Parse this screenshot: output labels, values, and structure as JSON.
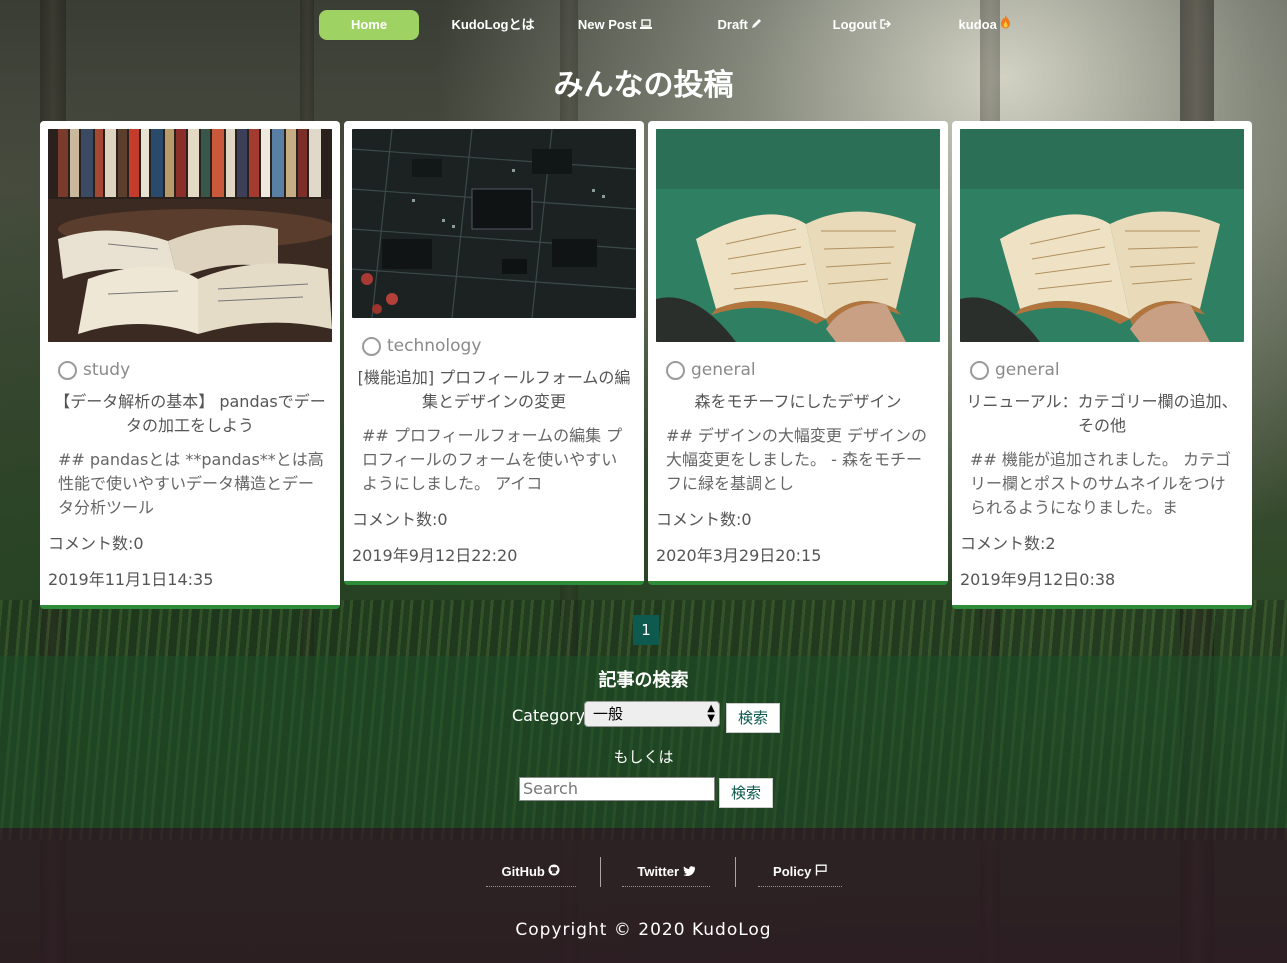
{
  "nav": {
    "home": "Home",
    "about": "KudoLogとは",
    "new_post": "New Post",
    "draft": "Draft",
    "logout": "Logout",
    "user": "kudoa"
  },
  "page_title": "みんなの投稿",
  "posts": [
    {
      "category": "study",
      "title": "【データ解析の基本】 pandasでデータの加工をしよう",
      "excerpt": "## pandasとは **pandas**とは高性能で使いやすいデータ構造とデータ分析ツール",
      "comments": "コメント数:0",
      "date": "2019年11月1日14:35",
      "image": "books-photo"
    },
    {
      "category": "technology",
      "title": "[機能追加] プロフィールフォームの編集とデザインの変更",
      "excerpt": "## プロフィールフォームの編集 プロフィールのフォームを使いやすいようにしました。 アイコ",
      "comments": "コメント数:0",
      "date": "2019年9月12日22:20",
      "image": "circuit-board-photo"
    },
    {
      "category": "general",
      "title": "森をモチーフにしたデザイン",
      "excerpt": "## デザインの大幅変更 デザインの大幅変更をしました。 - 森をモチーフに緑を基調とし",
      "comments": "コメント数:0",
      "date": "2020年3月29日20:15",
      "image": "reading-photo"
    },
    {
      "category": "general",
      "title": "リニューアル：カテゴリー欄の追加、その他",
      "excerpt": "## 機能が追加されました。 カテゴリー欄とポストのサムネイルをつけられるようになりました。ま",
      "comments": "コメント数:2",
      "date": "2019年9月12日0:38",
      "image": "reading-photo"
    }
  ],
  "pagination": {
    "current": "1"
  },
  "search": {
    "title": "記事の検索",
    "category_label": "Category:",
    "category_selected": "一般",
    "button": "検索",
    "or_label": "もしくは",
    "placeholder": "Search"
  },
  "footer": {
    "github": "GitHub",
    "twitter": "Twitter",
    "policy": "Policy",
    "copyright": "Copyright © 2020 KudoLog"
  },
  "colors": {
    "accent": "#9ed363",
    "card_border": "#2e8b3a",
    "pagination": "#0e5a4f"
  }
}
